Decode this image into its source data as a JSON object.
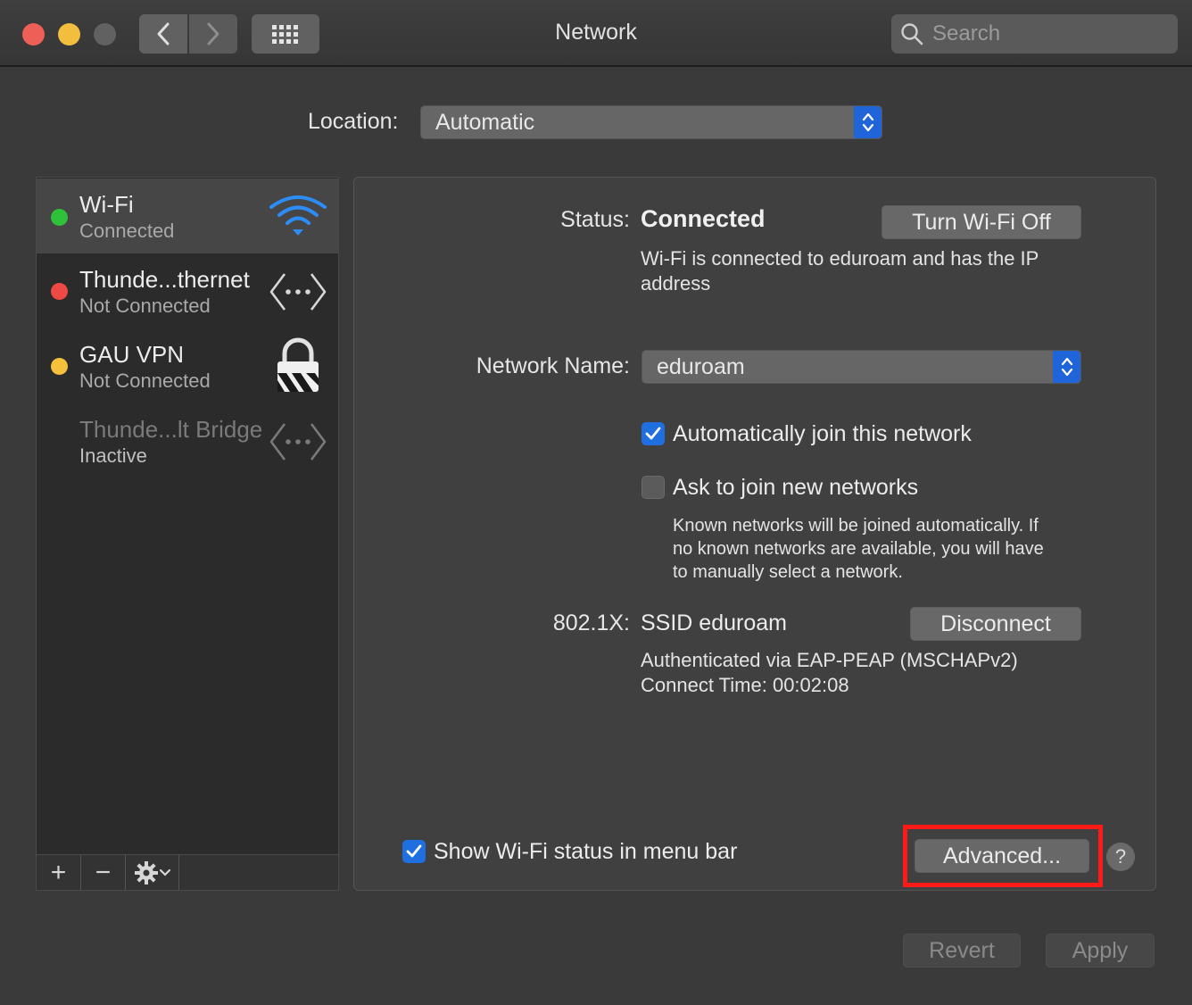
{
  "window": {
    "title": "Network"
  },
  "toolbar": {
    "search_placeholder": "Search"
  },
  "location": {
    "label": "Location:",
    "value": "Automatic"
  },
  "services": [
    {
      "name": "Wi-Fi",
      "status": "Connected",
      "status_color": "#30c13a",
      "icon": "wifi-icon"
    },
    {
      "name": "Thunde...thernet",
      "status": "Not Connected",
      "status_color": "#ee4a45",
      "icon": "ethernet-icon"
    },
    {
      "name": "GAU VPN",
      "status": "Not Connected",
      "status_color": "#f5c03b",
      "icon": "lock-icon"
    },
    {
      "name": "Thunde...lt Bridge",
      "status": "Inactive",
      "status_color": "",
      "icon": "ethernet-icon"
    }
  ],
  "list_toolbar": {
    "add": "+",
    "remove": "−"
  },
  "status": {
    "label": "Status:",
    "value": "Connected",
    "button": "Turn Wi-Fi Off",
    "description_line1": "Wi-Fi is connected to eduroam and has the IP",
    "description_line2": "address"
  },
  "network_name": {
    "label": "Network Name:",
    "value": "eduroam"
  },
  "auto_join": {
    "label": "Automatically join this network",
    "checked": true
  },
  "ask_join": {
    "label": "Ask to join new networks",
    "checked": false,
    "help_line1": "Known networks will be joined automatically. If",
    "help_line2": "no known networks are available, you will have",
    "help_line3": "to manually select a network."
  },
  "dot1x": {
    "label": "802.1X:",
    "value": "SSID eduroam",
    "button": "Disconnect",
    "auth": "Authenticated via EAP-PEAP (MSCHAPv2)",
    "connect_time": "Connect Time: 00:02:08"
  },
  "show_status": {
    "label": "Show Wi-Fi status in menu bar",
    "checked": true
  },
  "advanced_button": "Advanced...",
  "help_button": "?",
  "footer": {
    "revert": "Revert",
    "apply": "Apply"
  },
  "colors": {
    "accent": "#1f6fe0",
    "highlight": "#ff1a1a"
  }
}
